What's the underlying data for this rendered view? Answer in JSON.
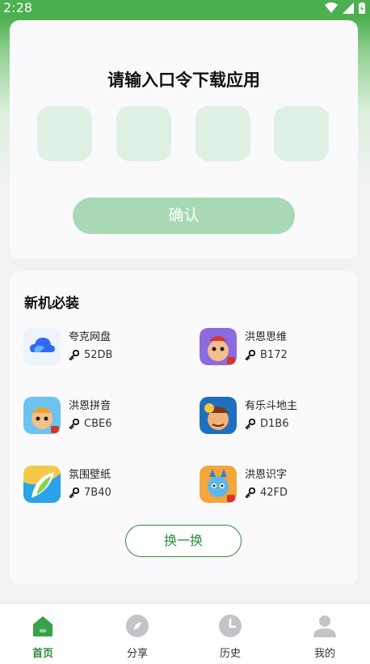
{
  "status_bar": {
    "time": "2:28"
  },
  "code_card": {
    "title": "请输入口令下载应用",
    "confirm_label": "确认"
  },
  "apps_card": {
    "title": "新机必装",
    "refresh_label": "换一换",
    "apps": [
      {
        "name": "夸克网盘",
        "code": "52DB",
        "icon": "quark-cloud-icon"
      },
      {
        "name": "洪恩思维",
        "code": "B172",
        "icon": "hongen-thinking-icon"
      },
      {
        "name": "洪恩拼音",
        "code": "CBE6",
        "icon": "hongen-pinyin-icon"
      },
      {
        "name": "有乐斗地主",
        "code": "D1B6",
        "icon": "youle-doudizhu-icon"
      },
      {
        "name": "氛围壁纸",
        "code": "7B40",
        "icon": "ambience-wallpaper-icon"
      },
      {
        "name": "洪恩识字",
        "code": "42FD",
        "icon": "hongen-literacy-icon"
      }
    ]
  },
  "tab_bar": {
    "tabs": [
      {
        "label": "首页",
        "icon": "home-icon",
        "active": true
      },
      {
        "label": "分享",
        "icon": "compass-icon",
        "active": false
      },
      {
        "label": "历史",
        "icon": "clock-icon",
        "active": false
      },
      {
        "label": "我的",
        "icon": "user-icon",
        "active": false
      }
    ]
  },
  "colors": {
    "accent": "#2e8b3a",
    "status_bar": "#4caf50",
    "code_box": "#dff0e4",
    "confirm_button": "#a8d8b4"
  }
}
